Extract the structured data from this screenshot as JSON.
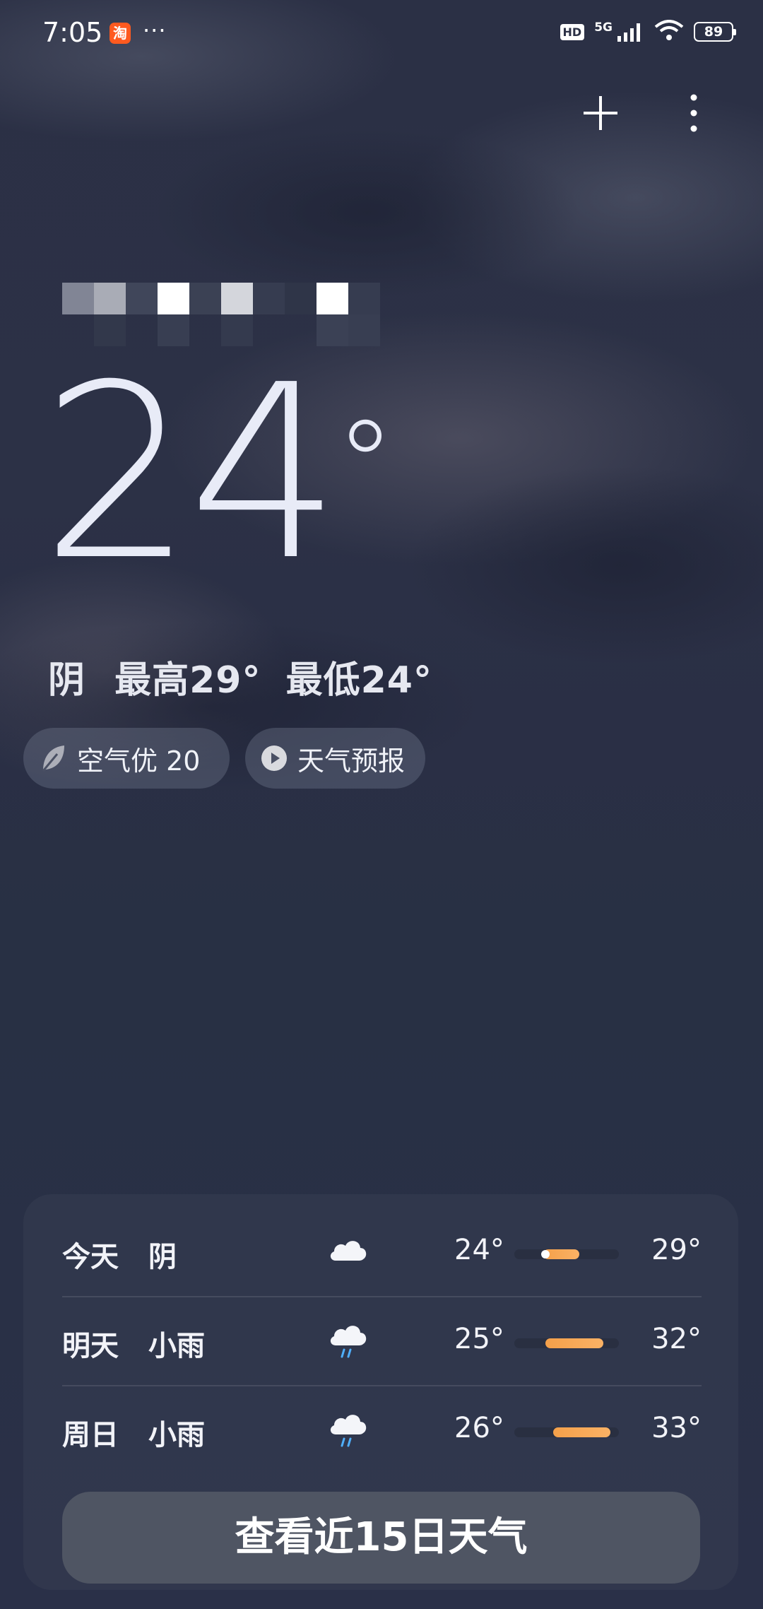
{
  "status_bar": {
    "time": "7:05",
    "app_badge": "淘",
    "more_dots": "···",
    "hd": "HD",
    "network": "5G",
    "battery": "89"
  },
  "current": {
    "temperature": "24",
    "degree_symbol": "°",
    "condition": "阴",
    "high": "最高29°",
    "low": "最低24°"
  },
  "chips": {
    "air_quality": "空气优 20",
    "forecast": "天气预报"
  },
  "forecast": [
    {
      "day": "今天",
      "condition": "阴",
      "icon": "cloud-icon",
      "low": "24°",
      "high": "29°",
      "range_start": 0.28,
      "range_end": 0.62,
      "now": 0.28
    },
    {
      "day": "明天",
      "condition": "小雨",
      "icon": "rain-cloud-icon",
      "low": "25°",
      "high": "32°",
      "range_start": 0.3,
      "range_end": 0.85
    },
    {
      "day": "周日",
      "condition": "小雨",
      "icon": "rain-cloud-icon",
      "low": "26°",
      "high": "33°",
      "range_start": 0.37,
      "range_end": 0.92
    }
  ],
  "more_button": "查看近15日天气",
  "colors": {
    "background": "#2b3045",
    "range_bar": "#f4a04a"
  }
}
